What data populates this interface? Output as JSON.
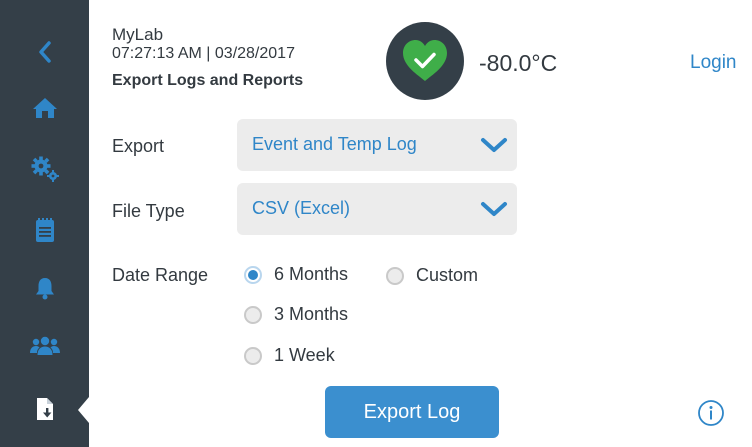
{
  "header": {
    "app_name": "MyLab",
    "datetime": "07:27:13 AM | 03/28/2017",
    "page_title": "Export Logs and Reports",
    "temperature": "-80.0°C",
    "login_label": "Login"
  },
  "sidebar": {
    "items": [
      {
        "icon": "back-icon"
      },
      {
        "icon": "home-icon"
      },
      {
        "icon": "settings-gears-icon"
      },
      {
        "icon": "clipboard-icon"
      },
      {
        "icon": "bell-icon"
      },
      {
        "icon": "users-icon"
      },
      {
        "icon": "file-download-icon",
        "active": true
      }
    ]
  },
  "form": {
    "export": {
      "label": "Export",
      "value": "Event and Temp Log"
    },
    "file_type": {
      "label": "File Type",
      "value": "CSV (Excel)"
    },
    "date_range": {
      "label": "Date Range",
      "options": [
        {
          "label": "6 Months",
          "selected": true
        },
        {
          "label": "Custom",
          "selected": false
        },
        {
          "label": "3 Months",
          "selected": false
        },
        {
          "label": "1 Week",
          "selected": false
        }
      ]
    }
  },
  "actions": {
    "export_button": "Export Log"
  },
  "colors": {
    "sidebar_bg": "#343f48",
    "accent": "#2f86c8",
    "button_bg": "#3b8fcf",
    "status_ok": "#3fae49"
  }
}
